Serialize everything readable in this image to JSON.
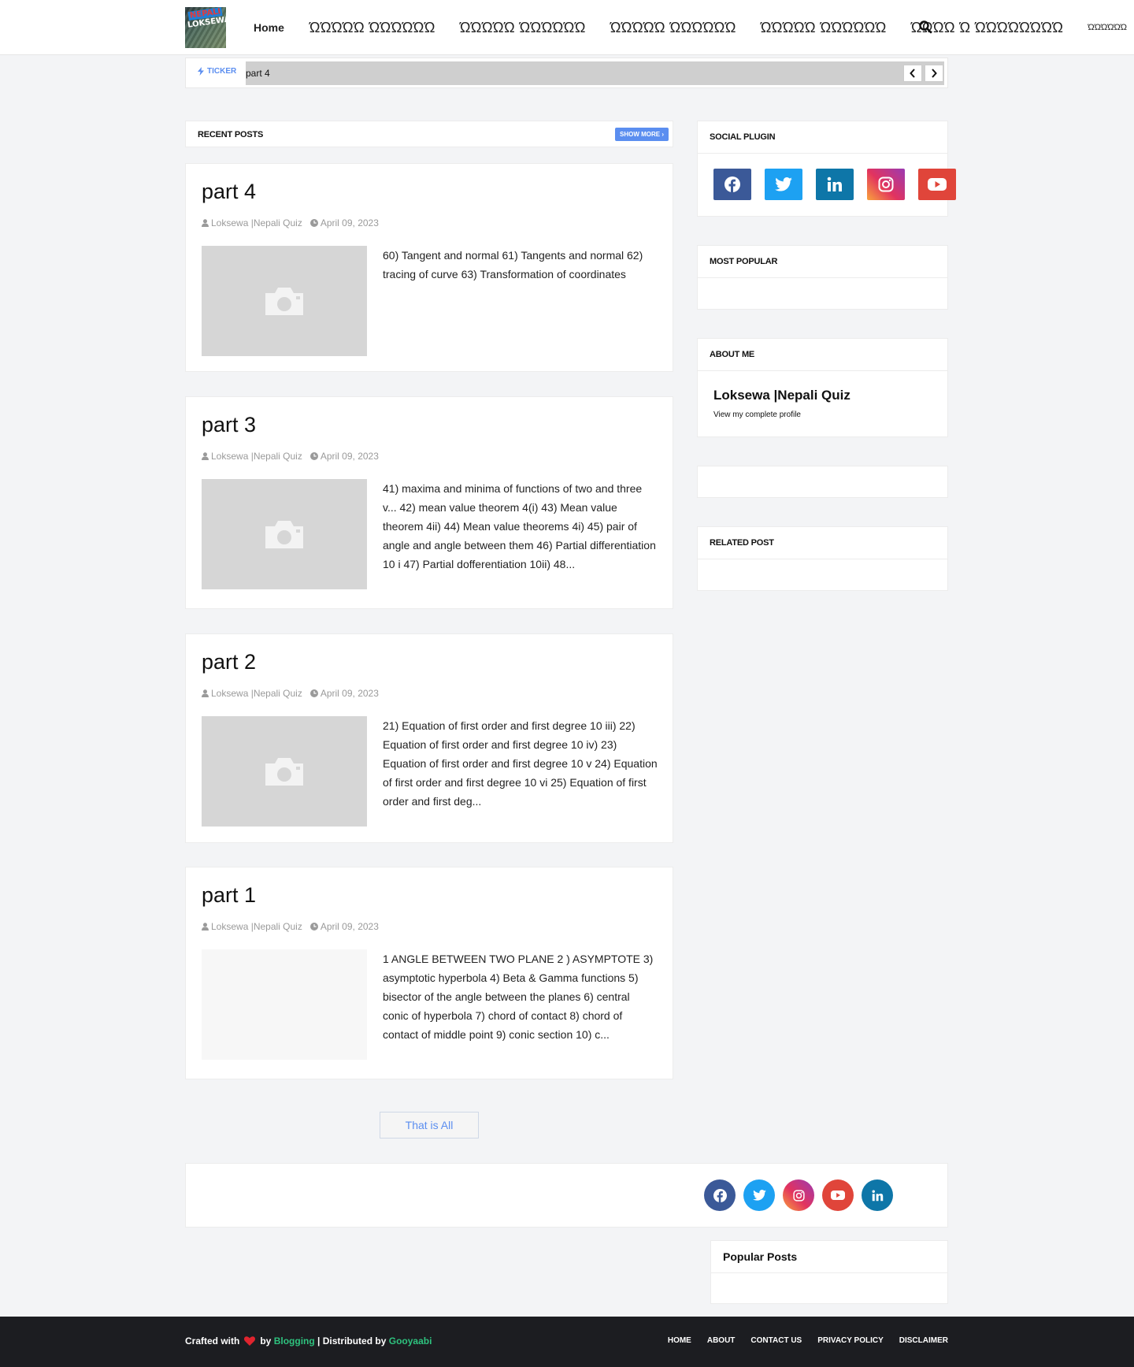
{
  "header": {
    "logo_text_top": "NEPALI",
    "logo_text_bottom": "LOKSEWA",
    "nav": [
      {
        "label": "Home"
      },
      {
        "label": "ΏΏΏΏΏ ΏΏΏΏΏΏ"
      },
      {
        "label": "ΏΏΏΏΏ ΏΏΏΏΏΏ"
      },
      {
        "label": "ΏΏΏΏΏ ΏΏΏΏΏΏ"
      },
      {
        "label": "ΏΏΏΏΏ ΏΏΏΏΏΏ"
      },
      {
        "label": "ΏΏΏΏ Ώ ΏΏΏΏΏΏΏΏ"
      },
      {
        "label": "ΏΏΏΏΏΏ"
      }
    ]
  },
  "ticker": {
    "label": "TICKER",
    "text": "part 4"
  },
  "recent": {
    "title": "RECENT POSTS",
    "show_more": "SHOW MORE"
  },
  "posts": [
    {
      "title": "part 4",
      "author": "Loksewa |Nepali Quiz",
      "date": "April 09, 2023",
      "snippet": "60) Tangent and normal  61) Tangents and normal 62) tracing of curve 63) Transformation of coordinates"
    },
    {
      "title": "part 3",
      "author": "Loksewa |Nepali Quiz",
      "date": "April 09, 2023",
      "snippet": "41) maxima and minima of functions of two and three v... 42) mean value theorem 4(i) 43) Mean value theorem 4ii) 44) Mean value theorems 4i) 45) pair of angle and angle between them 46) Partial differentiation 10 i 47) Partial dofferentiation 10ii) 48..."
    },
    {
      "title": "part 2",
      "author": "Loksewa |Nepali Quiz",
      "date": "April 09, 2023",
      "snippet": "21) Equation of first order and first degree 10 iii) 22) Equation of first order and first degree 10 iv) 23) Equation of first order and first degree 10 v 24) Equation of first order and first degree 10 vi 25) Equation of first order and first deg..."
    },
    {
      "title": "part 1",
      "author": "Loksewa |Nepali Quiz",
      "date": "April 09, 2023",
      "snippet": "1 ANGLE BETWEEN TWO PLANE 2 ) ASYMPTOTE 3) asymptotic hyperbola 4) Beta & Gamma functions 5) bisector of the angle between the planes 6) central conic of hyperbola 7) chord of contact 8) chord of contact of middle point 9) conic section 10) c..."
    }
  ],
  "pager": {
    "label": "That is All"
  },
  "sidebar": {
    "social_title": "SOCIAL PLUGIN",
    "popular_title": "MOST POPULAR",
    "about_title": "ABOUT ME",
    "about_name": "Loksewa |Nepali Quiz",
    "about_link": "View my complete profile",
    "related_title": "RELATED POST"
  },
  "footer": {
    "popular_posts_title": "Popular Posts",
    "crafted_with": "Crafted with",
    "by": "by",
    "blogging": "Blogging",
    "distributed_by": "| Distributed by",
    "gooyaabi": "Gooyaabi",
    "links": [
      {
        "label": "HOME"
      },
      {
        "label": "ABOUT"
      },
      {
        "label": "CONTACT US"
      },
      {
        "label": "PRIVACY POLICY"
      },
      {
        "label": "DISCLAIMER"
      }
    ]
  },
  "colors": {
    "accent": "#5b8ef0",
    "facebook": "#3b5998",
    "twitter": "#1da1f2",
    "linkedin": "#0e76a8",
    "youtube": "#e0453a",
    "footer_bg": "#1c1d21",
    "credit_green": "#2ec27e",
    "heart": "#e0242e"
  }
}
